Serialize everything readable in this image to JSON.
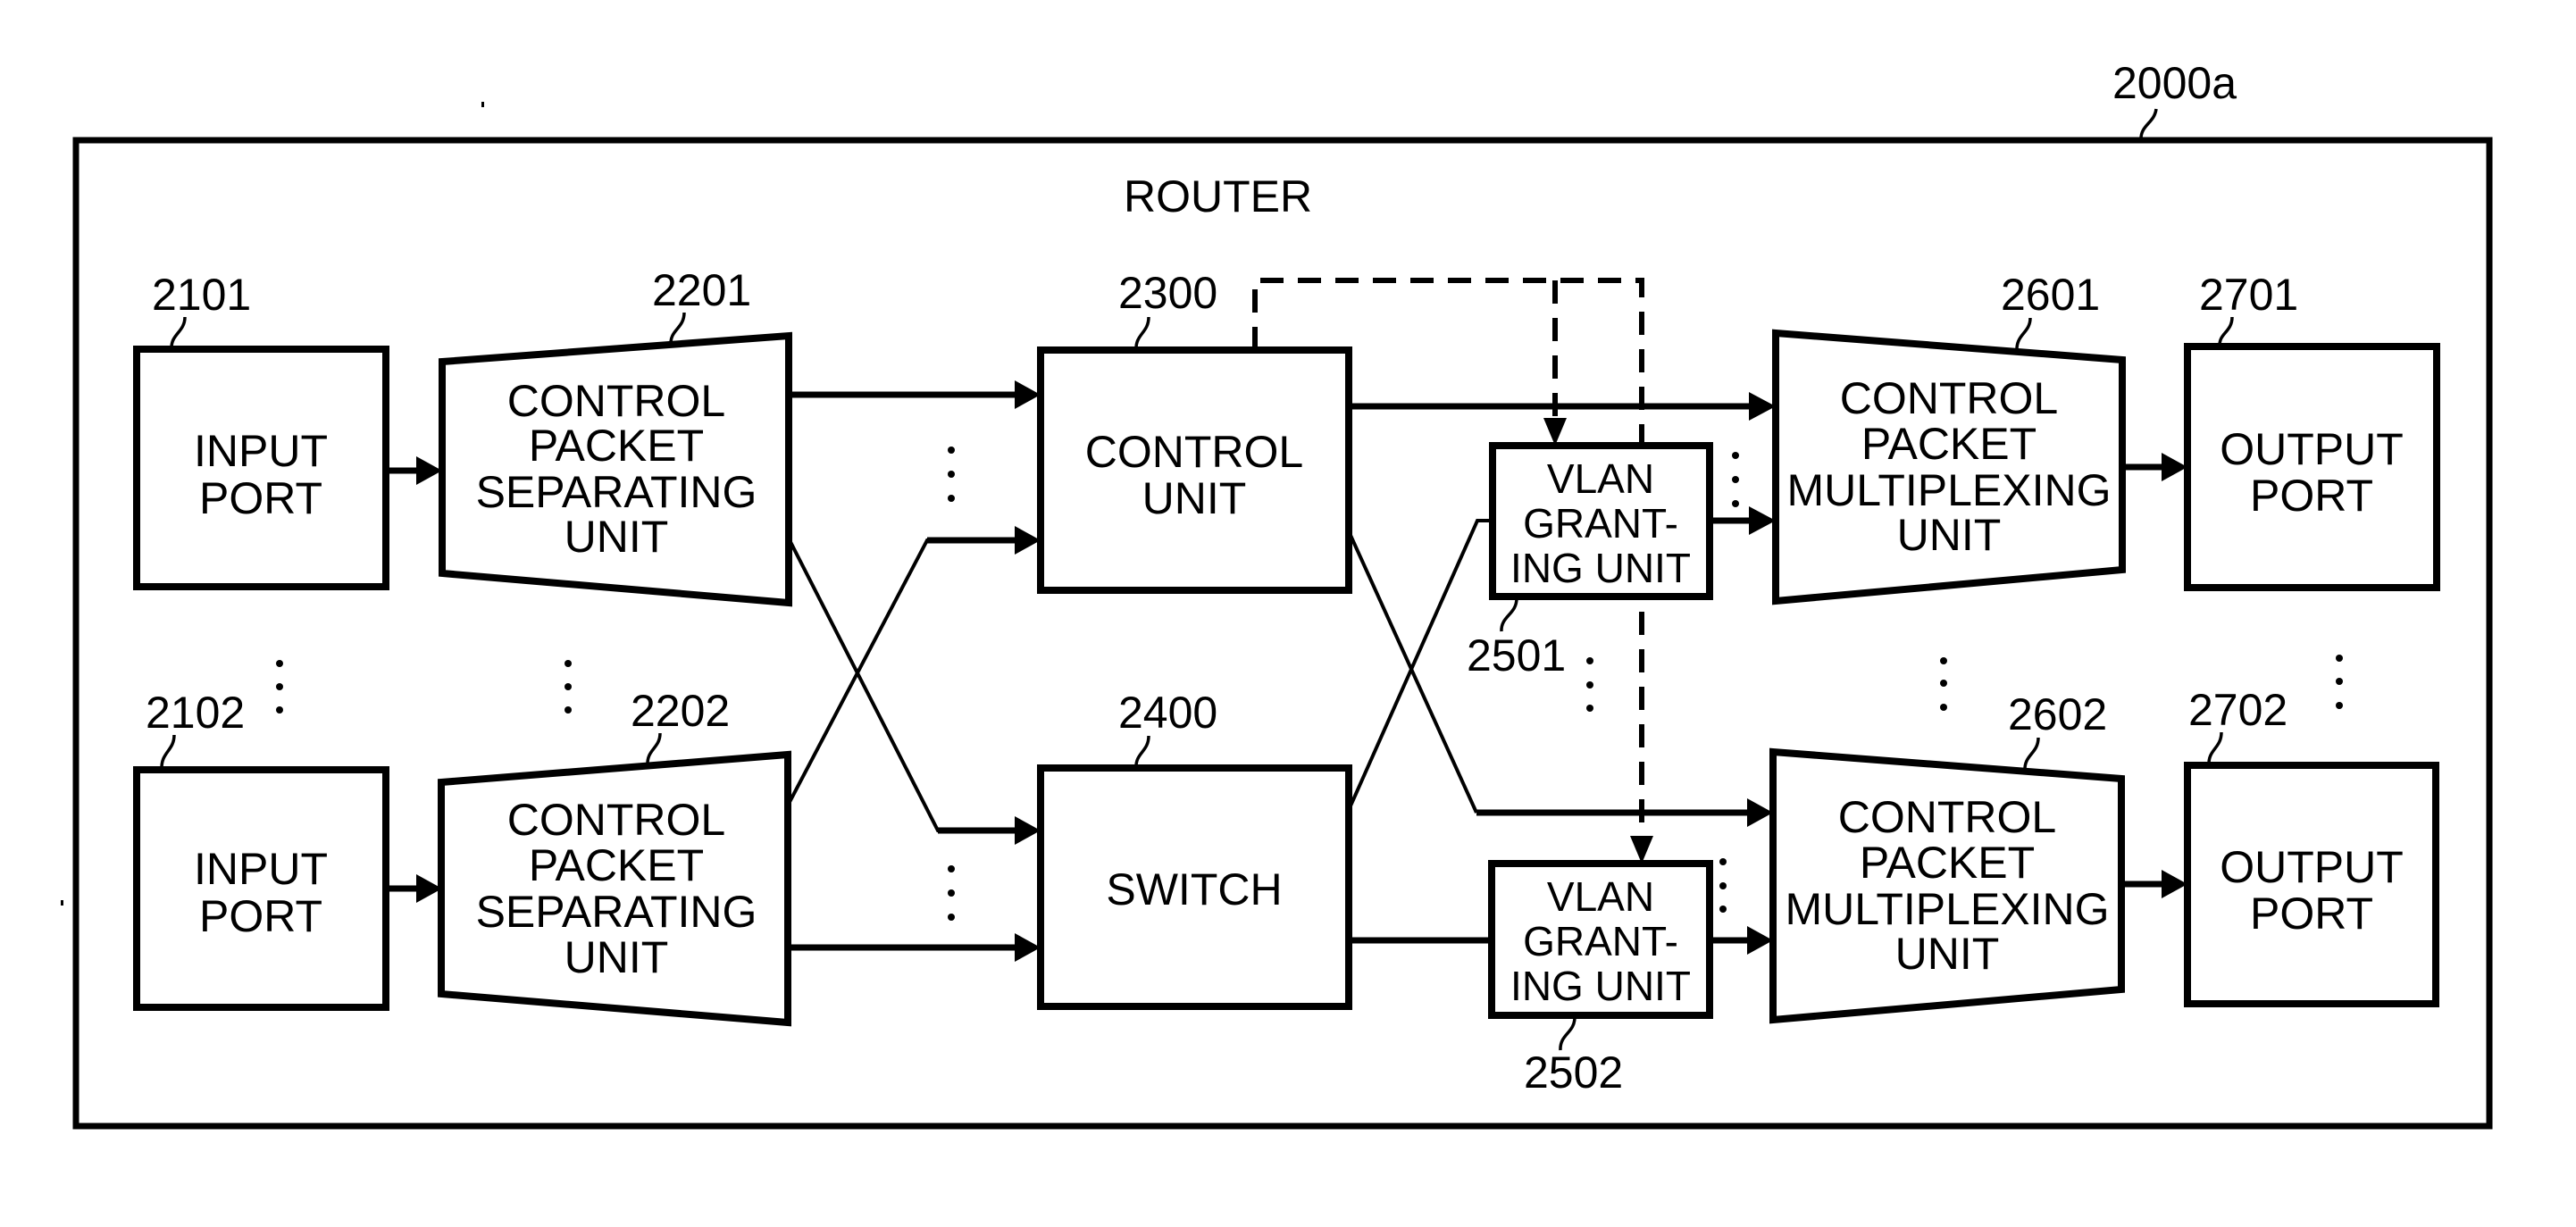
{
  "figure": {
    "reference": "2000a",
    "title": "ROUTER"
  },
  "blocks": {
    "input_port_1": {
      "ref": "2101",
      "lines": [
        "INPUT",
        "PORT"
      ]
    },
    "input_port_2": {
      "ref": "2102",
      "lines": [
        "INPUT",
        "PORT"
      ]
    },
    "separator_1": {
      "ref": "2201",
      "lines": [
        "CONTROL",
        "PACKET",
        "SEPARATING",
        "UNIT"
      ]
    },
    "separator_2": {
      "ref": "2202",
      "lines": [
        "CONTROL",
        "PACKET",
        "SEPARATING",
        "UNIT"
      ]
    },
    "control_unit": {
      "ref": "2300",
      "lines": [
        "CONTROL",
        "UNIT"
      ]
    },
    "switch": {
      "ref": "2400",
      "lines": [
        "SWITCH"
      ]
    },
    "vlan_1": {
      "ref": "2501",
      "lines": [
        "VLAN",
        "GRANT-",
        "ING UNIT"
      ]
    },
    "vlan_2": {
      "ref": "2502",
      "lines": [
        "VLAN",
        "GRANT-",
        "ING UNIT"
      ]
    },
    "multiplexer_1": {
      "ref": "2601",
      "lines": [
        "CONTROL",
        "PACKET",
        "MULTIPLEXING",
        "UNIT"
      ]
    },
    "multiplexer_2": {
      "ref": "2602",
      "lines": [
        "CONTROL",
        "PACKET",
        "MULTIPLEXING",
        "UNIT"
      ]
    },
    "output_port_1": {
      "ref": "2701",
      "lines": [
        "OUTPUT",
        "PORT"
      ]
    },
    "output_port_2": {
      "ref": "2702",
      "lines": [
        "OUTPUT",
        "PORT"
      ]
    }
  },
  "connections": [
    {
      "from": "input_port_1",
      "to": "separator_1",
      "style": "solid-arrow"
    },
    {
      "from": "input_port_2",
      "to": "separator_2",
      "style": "solid-arrow"
    },
    {
      "from": "separator_1",
      "to": "control_unit",
      "style": "solid-arrow"
    },
    {
      "from": "separator_1",
      "to": "switch",
      "style": "solid-arrow"
    },
    {
      "from": "separator_2",
      "to": "control_unit",
      "style": "solid-arrow"
    },
    {
      "from": "separator_2",
      "to": "switch",
      "style": "solid-arrow"
    },
    {
      "from": "control_unit",
      "to": "multiplexer_1",
      "style": "solid-arrow"
    },
    {
      "from": "control_unit",
      "to": "multiplexer_2",
      "style": "solid-arrow"
    },
    {
      "from": "switch",
      "to": "vlan_1",
      "style": "solid-line"
    },
    {
      "from": "switch",
      "to": "vlan_2",
      "style": "solid-line"
    },
    {
      "from": "vlan_1",
      "to": "multiplexer_1",
      "style": "solid-arrow"
    },
    {
      "from": "vlan_2",
      "to": "multiplexer_2",
      "style": "solid-arrow"
    },
    {
      "from": "multiplexer_1",
      "to": "output_port_1",
      "style": "solid-arrow"
    },
    {
      "from": "multiplexer_2",
      "to": "output_port_2",
      "style": "solid-arrow"
    },
    {
      "from": "control_unit",
      "to": "vlan_1",
      "style": "dashed-arrow"
    },
    {
      "from": "control_unit",
      "to": "vlan_2",
      "style": "dashed-arrow"
    }
  ],
  "ellipsis_glyph": "vertical-dots"
}
